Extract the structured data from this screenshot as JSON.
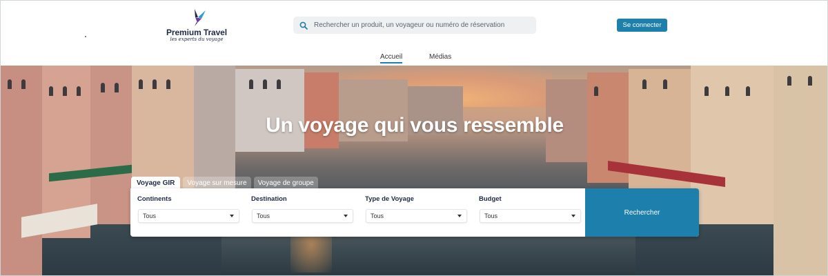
{
  "header": {
    "logo": {
      "name": "Premium Travel",
      "tagline": "les experts du voyage"
    },
    "search": {
      "placeholder": "Rechercher un produit, un voyageur ou numéro de réservation",
      "value": ""
    },
    "login_label": "Se connecter"
  },
  "nav": {
    "items": [
      {
        "label": "Accueil",
        "active": true
      },
      {
        "label": "Médias",
        "active": false
      }
    ]
  },
  "hero": {
    "title": "Un voyage qui vous ressemble"
  },
  "tabs": [
    {
      "label": "Voyage GIR",
      "active": true
    },
    {
      "label": "Voyage sur mesure",
      "active": false
    },
    {
      "label": "Voyage de groupe",
      "active": false
    }
  ],
  "form": {
    "fields": [
      {
        "label": "Continents",
        "value": "Tous"
      },
      {
        "label": "Destination",
        "value": "Tous"
      },
      {
        "label": "Type de Voyage",
        "value": "Tous"
      },
      {
        "label": "Budget",
        "value": "Tous"
      }
    ],
    "submit_label": "Rechercher"
  },
  "colors": {
    "accent": "#1d7fac",
    "brand_text": "#1e2a44"
  }
}
